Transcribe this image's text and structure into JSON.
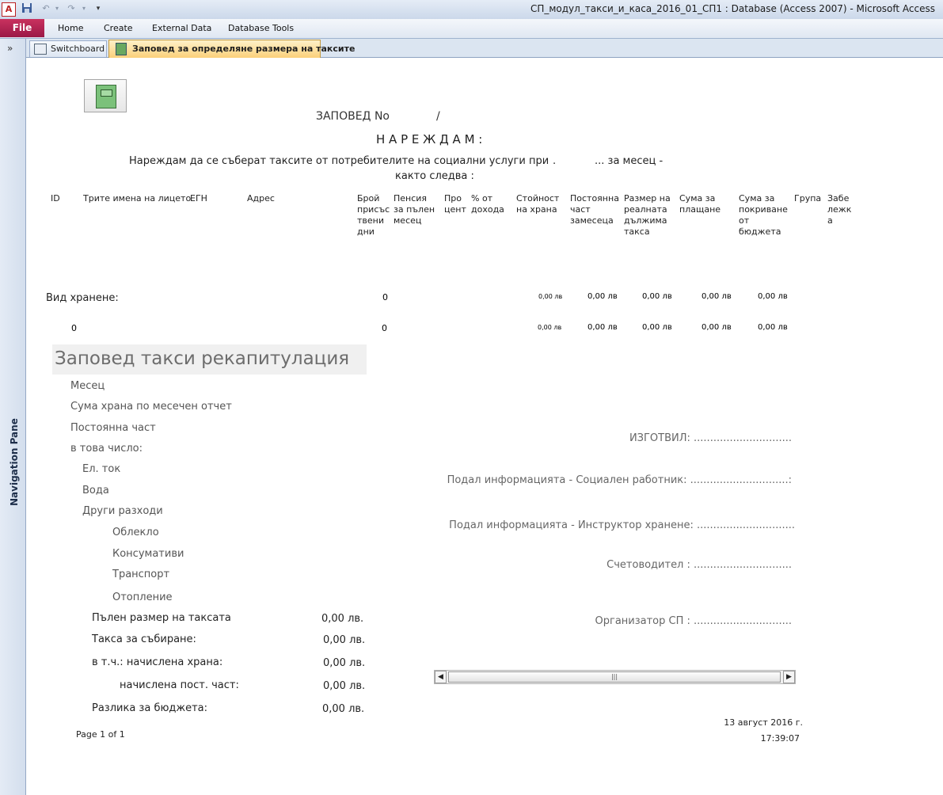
{
  "window": {
    "title": "СП_модул_такси_и_каса_2016_01_СП1 : Database (Access 2007)  -  Microsoft Access",
    "app_icon": "A"
  },
  "ribbon": {
    "tabs": [
      "File",
      "Home",
      "Create",
      "External Data",
      "Database Tools"
    ]
  },
  "nav_pane": {
    "label": "Navigation Pane",
    "toggle": "»"
  },
  "doc_tabs": [
    {
      "label": "Switchboard"
    },
    {
      "label": "Заповед за определяне размера на таксите"
    }
  ],
  "report": {
    "heading": "ЗАПОВЕД No",
    "slash": "/",
    "order_word": "Н А Р Е Ж Д А М :",
    "intro": "Нареждам да се съберат таксите от потребителите на социални услуги при",
    "intro_dot": ".",
    "intro_month": "...  за месец  -",
    "intro2": "както следва :",
    "columns": [
      {
        "label": "ID"
      },
      {
        "label": "Трите имена на лицето"
      },
      {
        "label": "ЕГН"
      },
      {
        "label": "Адрес"
      },
      {
        "label": "Брой присъс твени дни"
      },
      {
        "label": "Пенсия за пълен месец"
      },
      {
        "label": "Про цент"
      },
      {
        "label": "% от дохода"
      },
      {
        "label": "Стойност на храна"
      },
      {
        "label": "Постоянна част замесеца"
      },
      {
        "label": "Размер на реалната дължима такса"
      },
      {
        "label": "Сума за плащане"
      },
      {
        "label": "Сума за покриване от бюджета"
      },
      {
        "label": "Група"
      },
      {
        "label": "Забе лежк а"
      }
    ],
    "group_row": {
      "label": "Вид хранене:",
      "days": "0",
      "food": "0,00 лв",
      "fixed": "0,00 лв",
      "real": "0,00 лв",
      "pay": "0,00 лв",
      "budget": "0,00 лв"
    },
    "total_row": {
      "label": "0",
      "days": "0",
      "food": "0,00 лв",
      "fixed": "0,00 лв",
      "real": "0,00 лв",
      "pay": "0,00 лв",
      "budget": "0,00 лв"
    }
  },
  "recap": {
    "title": "Заповед такси рекапитулация",
    "items": [
      "Месец",
      "Сума храна по месечен отчет",
      "Постоянна част",
      "в това число:",
      "Ел. ток",
      "Вода",
      "Други разходи",
      "Облекло",
      "Консумативи",
      "Транспорт",
      "Отопление"
    ],
    "totals": [
      {
        "label": "Пълен размер на таксата",
        "value": "0,00 лв."
      },
      {
        "label": "Такса за събиране:",
        "value": "0,00 лв."
      },
      {
        "label": "в т.ч.: начислена храна:",
        "value": "0,00 лв."
      },
      {
        "label": "начислена пост. част:",
        "value": "0,00 лв."
      },
      {
        "label": "Разлика за бюджета:",
        "value": "0,00 лв."
      }
    ]
  },
  "signatures": [
    "ИЗГОТВИЛ: ..............................",
    "Подал информацията - Социален работник: ..............................:",
    "Подал информацията - Инструктор хранене: ..............................",
    "Счетоводител : ..............................",
    "Организатор СП : .............................."
  ],
  "footer": {
    "page": "Page 1 of 1",
    "date": "13 август 2016 г.",
    "time": "17:39:07"
  },
  "scrollbar": {
    "left_arrow": "◀",
    "right_arrow": "▶",
    "grip": "|||"
  }
}
